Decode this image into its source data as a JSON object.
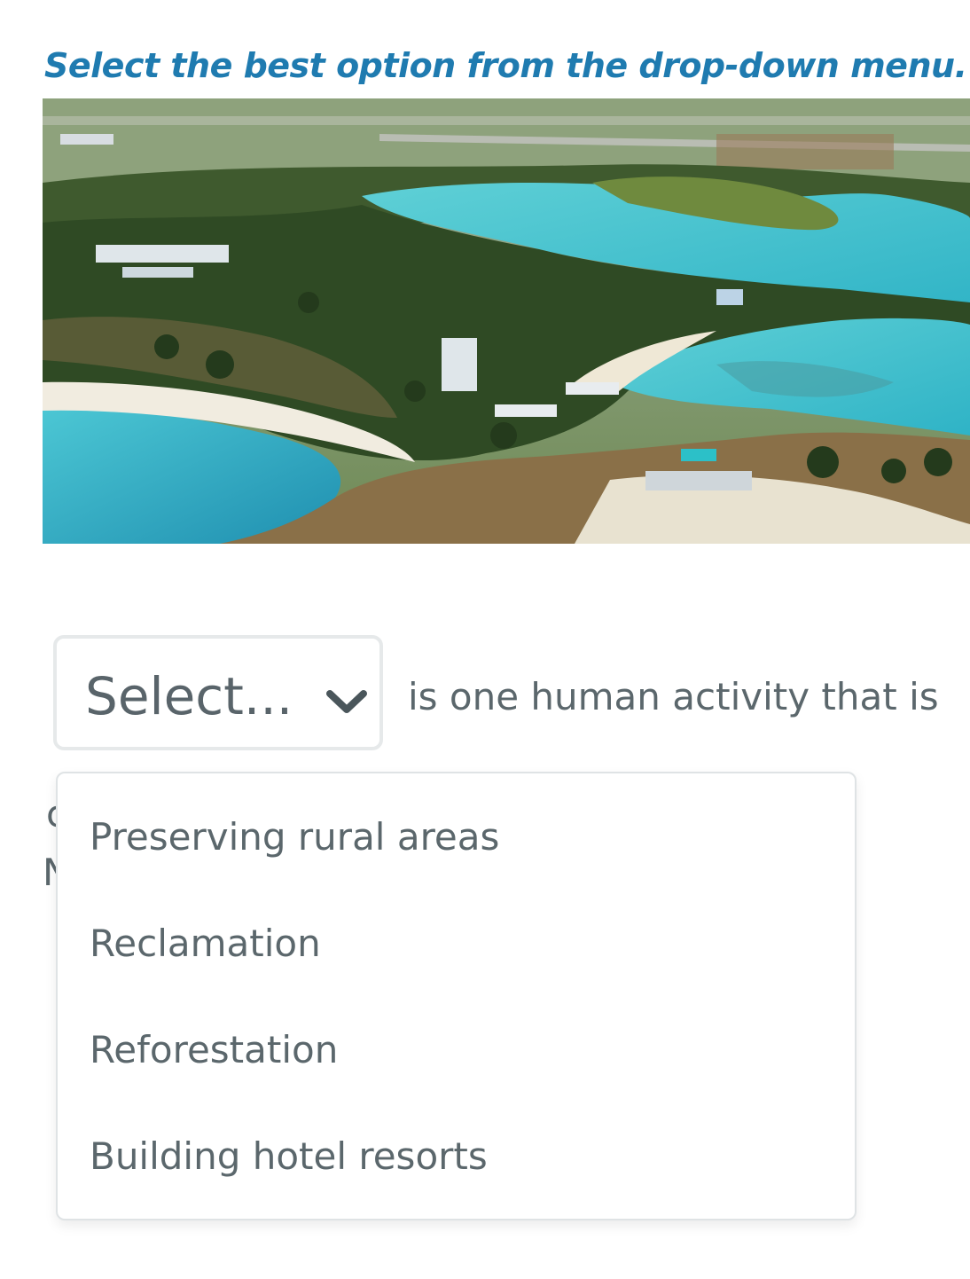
{
  "instruction": "Select the best option from the drop-down menu.",
  "photo": {
    "description_icon": "aerial-coastal-resort-image"
  },
  "question": {
    "select_placeholder": "Select...",
    "sentence_rest": "is one human activity that is",
    "hidden_line_fragments": [
      "c",
      "N"
    ]
  },
  "dropdown": {
    "options": [
      "Preserving rural areas",
      "Reclamation",
      "Reforestation",
      "Building hotel resorts"
    ]
  },
  "colors": {
    "instruction": "#1f7bb0",
    "text": "#5b676c",
    "border": "#e6e9ea"
  }
}
